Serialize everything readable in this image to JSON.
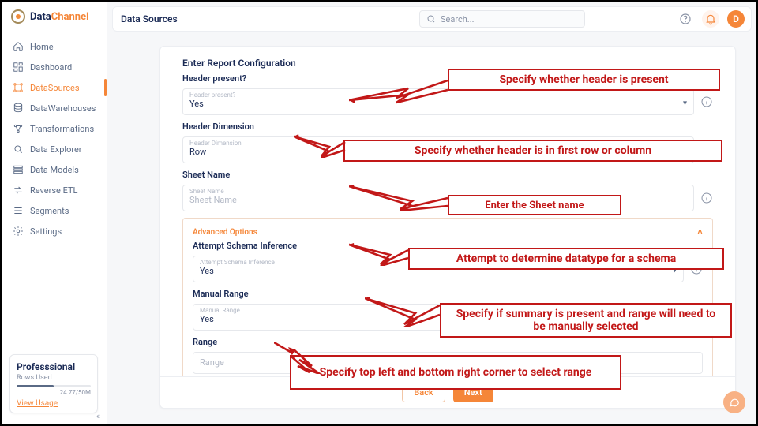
{
  "brand": {
    "name_a": "Data",
    "name_b": "Channel"
  },
  "page_title": "Data Sources",
  "search_placeholder": "Search...",
  "avatar_initial": "D",
  "sidebar": {
    "items": [
      {
        "label": "Home",
        "active": false
      },
      {
        "label": "Dashboard",
        "active": false
      },
      {
        "label": "DataSources",
        "active": true
      },
      {
        "label": "DataWarehouses",
        "active": false
      },
      {
        "label": "Transformations",
        "active": false
      },
      {
        "label": "Data Explorer",
        "active": false
      },
      {
        "label": "Data Models",
        "active": false
      },
      {
        "label": "Reverse ETL",
        "active": false
      },
      {
        "label": "Segments",
        "active": false
      },
      {
        "label": "Settings",
        "active": false
      }
    ]
  },
  "plan": {
    "name": "Professsional",
    "sub": "Rows Used",
    "count": "24.77/50M",
    "link": "View Usage"
  },
  "form": {
    "section_title": "Enter Report Configuration",
    "header_present": {
      "label": "Header present?",
      "floating": "Header present?",
      "value": "Yes"
    },
    "header_dimension": {
      "label": "Header Dimension",
      "floating": "Header Dimension",
      "value": "Row"
    },
    "sheet_name": {
      "label": "Sheet Name",
      "floating": "Sheet Name",
      "placeholder": "Sheet Name",
      "value": ""
    },
    "adv_title": "Advanced Options",
    "schema_inference": {
      "label": "Attempt Schema Inference",
      "floating": "Attempt Schema Inference",
      "value": "Yes"
    },
    "manual_range": {
      "label": "Manual Range",
      "floating": "Manual Range",
      "value": "Yes"
    },
    "range": {
      "label": "Range",
      "floating": "Range",
      "placeholder": "Range",
      "value": ""
    },
    "back": "Back",
    "next": "Next"
  },
  "callouts": {
    "c1": "Specify whether header is present",
    "c2": "Specify whether header is in first row or column",
    "c3": "Enter the Sheet name",
    "c4": "Attempt to determine datatype for a schema",
    "c5": "Specify if summary is present and range will need to be manually selected",
    "c6": "Specify top left and bottom right corner to select range"
  }
}
